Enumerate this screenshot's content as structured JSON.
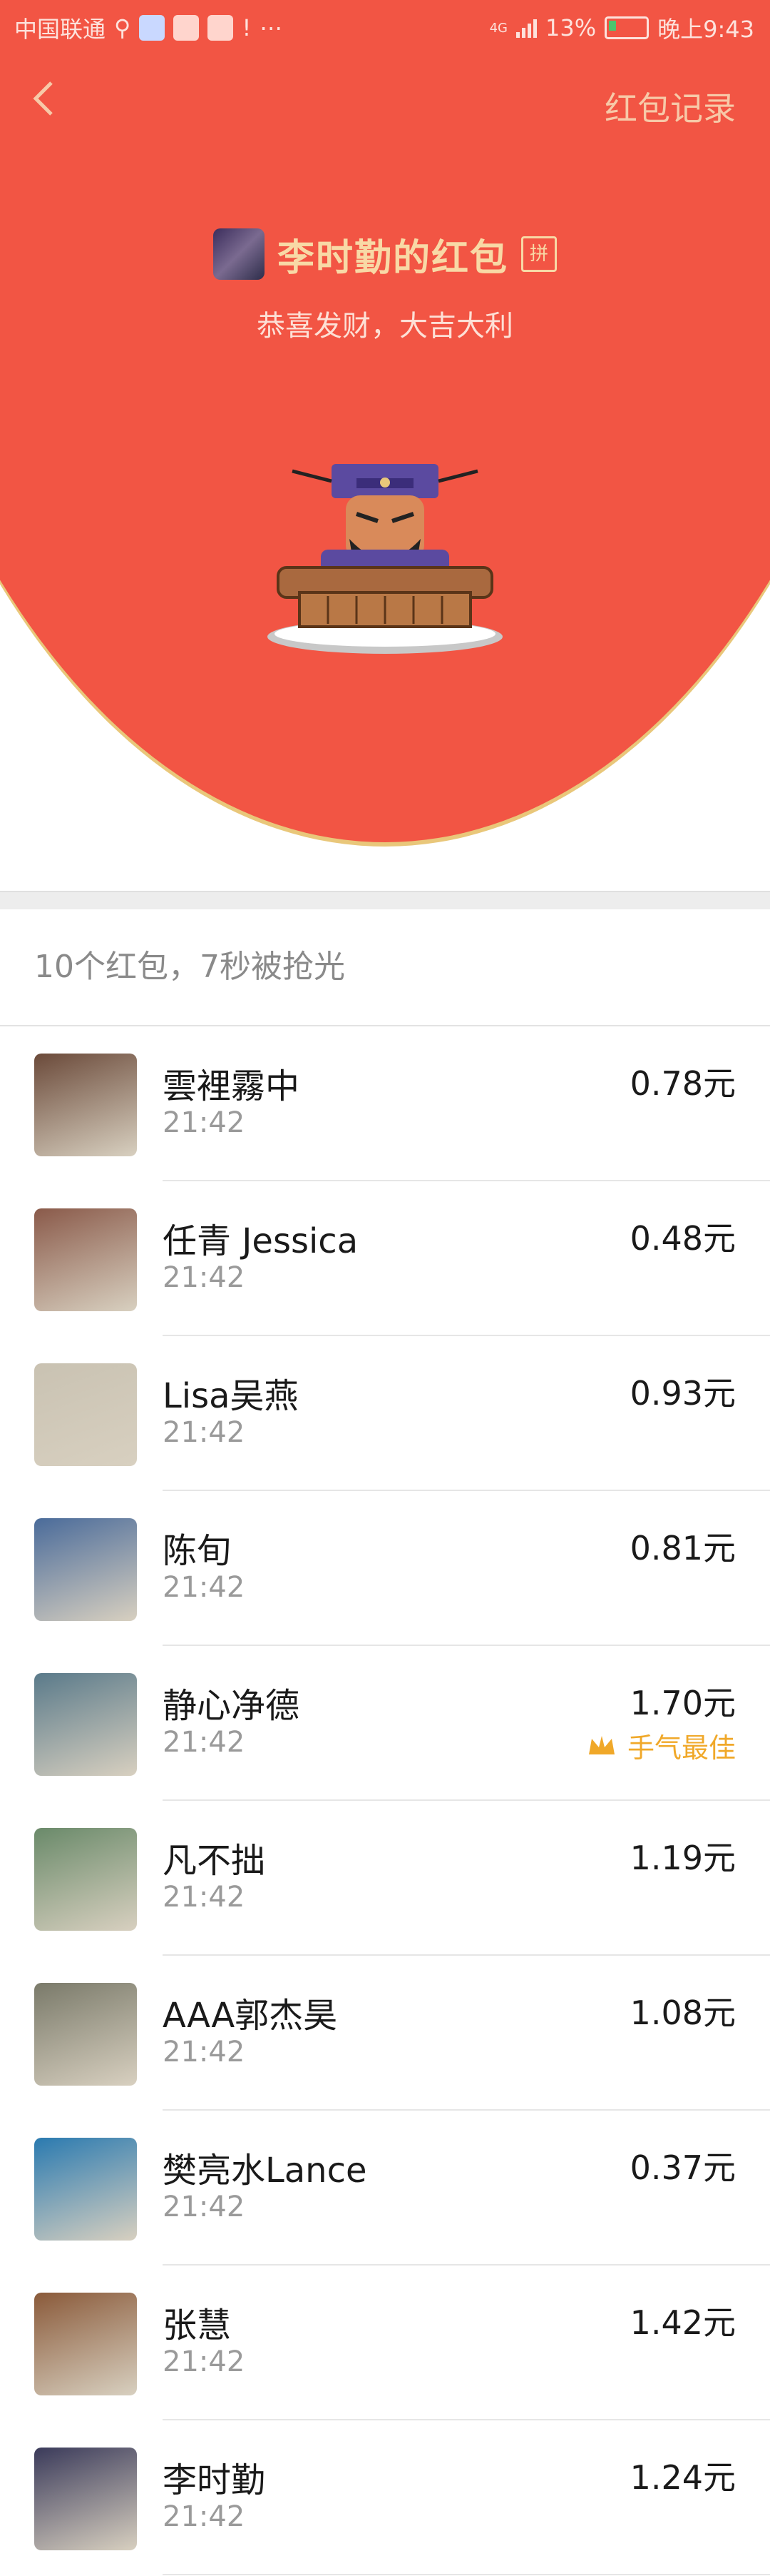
{
  "statusbar": {
    "carrier": "中国联通",
    "extra": "⋯",
    "network": "4G",
    "battery": "13%",
    "time": "晚上9:43"
  },
  "header": {
    "back_icon": "back-chevron-icon",
    "record_link": "红包记录",
    "title": "李时勤的红包",
    "pin_badge": "拼",
    "subtitle": "恭喜发财，大吉大利",
    "mascot_icon": "judge-mascot-icon"
  },
  "summary": "10个红包，7秒被抢光",
  "receivers": [
    {
      "name": "雲裡霧中",
      "time": "21:42",
      "amount": "0.78元",
      "avatar_color": "#6b4a3a"
    },
    {
      "name": "任青 Jessica",
      "time": "21:42",
      "amount": "0.48元",
      "avatar_color": "#8a5a4a"
    },
    {
      "name": "Lisa吴燕",
      "time": "21:42",
      "amount": "0.93元",
      "avatar_color": "#c9c2b2"
    },
    {
      "name": "陈旬",
      "time": "21:42",
      "amount": "0.81元",
      "avatar_color": "#4a6b9a"
    },
    {
      "name": "静心净德",
      "time": "21:42",
      "amount": "1.70元",
      "best": "手气最佳",
      "avatar_color": "#5a7a8a"
    },
    {
      "name": "凡不拙",
      "time": "21:42",
      "amount": "1.19元",
      "avatar_color": "#6a8a6a"
    },
    {
      "name": "AAA郭杰昊",
      "time": "21:42",
      "amount": "1.08元",
      "avatar_color": "#7a7a6a"
    },
    {
      "name": "樊亮水Lance",
      "time": "21:42",
      "amount": "0.37元",
      "avatar_color": "#2a7ab0"
    },
    {
      "name": "张慧",
      "time": "21:42",
      "amount": "1.42元",
      "avatar_color": "#8a5a3a"
    },
    {
      "name": "李时勤",
      "time": "21:42",
      "amount": "1.24元",
      "avatar_color": "#3a3a5a"
    }
  ],
  "colors": {
    "red": "#f25544",
    "gold": "#f8d9a6",
    "best": "#f0a829"
  }
}
